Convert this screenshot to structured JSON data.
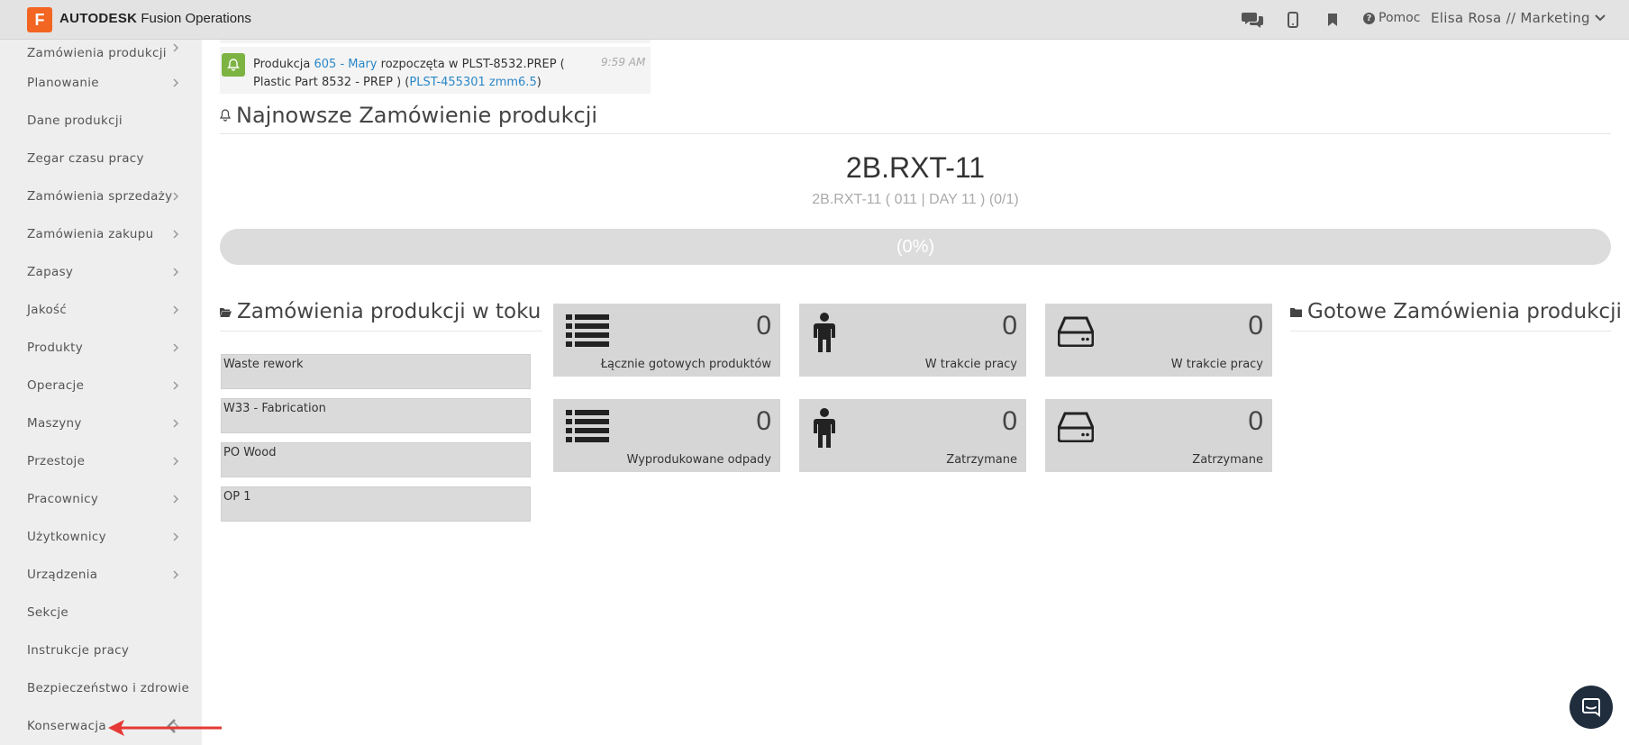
{
  "header": {
    "logo_letter": "F",
    "brand_bold": "AUTODESK",
    "brand_rest": "Fusion Operations",
    "help_label": "Pomoc",
    "user_label": "Elisa Rosa // Marketing",
    "icons": [
      "chat-icon",
      "mobile-icon",
      "bookmark-icon",
      "help-icon",
      "chevron-down-icon"
    ]
  },
  "sidebar": {
    "items": [
      {
        "label": "Zamówienia produkcji",
        "has_chevron": true
      },
      {
        "label": "Planowanie",
        "has_chevron": true
      },
      {
        "label": "Dane produkcji",
        "has_chevron": false
      },
      {
        "label": "Zegar czasu pracy",
        "has_chevron": false
      },
      {
        "label": "Zamówienia sprzedaży",
        "has_chevron": true
      },
      {
        "label": "Zamówienia zakupu",
        "has_chevron": true
      },
      {
        "label": "Zapasy",
        "has_chevron": true
      },
      {
        "label": "Jakość",
        "has_chevron": true
      },
      {
        "label": "Produkty",
        "has_chevron": true
      },
      {
        "label": "Operacje",
        "has_chevron": true
      },
      {
        "label": "Maszyny",
        "has_chevron": true
      },
      {
        "label": "Przestoje",
        "has_chevron": true
      },
      {
        "label": "Pracownicy",
        "has_chevron": true
      },
      {
        "label": "Użytkownicy",
        "has_chevron": true
      },
      {
        "label": "Urządzenia",
        "has_chevron": true
      },
      {
        "label": "Sekcje",
        "has_chevron": false
      },
      {
        "label": "Instrukcje pracy",
        "has_chevron": false
      },
      {
        "label": "Bezpieczeństwo i zdrowie",
        "has_chevron": false
      },
      {
        "label": "Konserwacja",
        "has_chevron": true
      }
    ]
  },
  "notification": {
    "prefix": "Produkcja",
    "link1": "605 - Mary",
    "middle": "rozpoczęta w PLST-8532.PREP ( Plastic Part 8532 - PREP ) (",
    "link2": "PLST-455301 zmm6.5",
    "suffix": ")",
    "time": "9:59 AM"
  },
  "latest": {
    "title": "Najnowsze Zamówienie produkcji",
    "order_id": "2B.RXT-11",
    "order_sub": "2B.RXT-11 ( 011 | DAY 11 ) (0/1)",
    "progress_label": "(0%)",
    "progress": 0
  },
  "wip": {
    "title": "Zamówienia produkcji w toku",
    "items": [
      "Waste rework",
      "W33 - Fabrication",
      "PO Wood",
      "OP 1"
    ]
  },
  "tiles": [
    {
      "icon": "list-icon",
      "value": "0",
      "label": "Łącznie gotowych produktów"
    },
    {
      "icon": "person-icon",
      "value": "0",
      "label": "W trakcie pracy"
    },
    {
      "icon": "drive-icon",
      "value": "0",
      "label": "W trakcie pracy"
    },
    {
      "icon": "list-icon",
      "value": "0",
      "label": "Wyprodukowane odpady"
    },
    {
      "icon": "person-icon",
      "value": "0",
      "label": "Zatrzymane"
    },
    {
      "icon": "drive-icon",
      "value": "0",
      "label": "Zatrzymane"
    }
  ],
  "done": {
    "title": "Gotowe Zamówienia produkcji"
  },
  "colors": {
    "accent_blue": "#2a87c8",
    "bell_green": "#7cb342",
    "logo_orange": "#f26522",
    "annotation_red": "#e53935"
  }
}
